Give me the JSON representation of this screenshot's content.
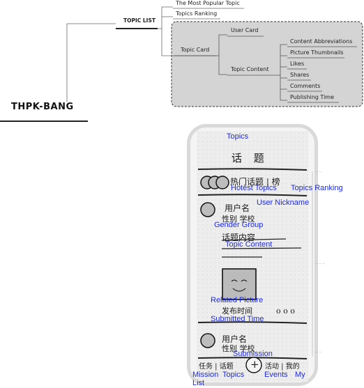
{
  "mindmap": {
    "root": "THPK-BANG",
    "topic_list": "TOPIC LIST",
    "most_popular": "The Most Popular Topic",
    "topics_ranking": "Topics Ranking",
    "topic_card": "Topic Card",
    "user_card": "User Card",
    "topic_content": "Topic Content",
    "content_items": [
      "Content Abbreviations",
      "Picture Thumbnails",
      "Likes",
      "Shares",
      "Comments",
      "Publishing Time"
    ]
  },
  "sketch": {
    "handwritten": {
      "title": "话 题",
      "hot_ranking": "热门话题 | 榜",
      "username": "用户名",
      "gender_school": "性别 学校",
      "topic_content": "话题内容",
      "submit_time": "发布时间",
      "dots": "o o o",
      "username2": "用户名",
      "gender_school2": "性别 学校",
      "bottom_left": "任务 | 话题",
      "plus": "+",
      "bottom_right": "活动 | 我的"
    },
    "annotations": {
      "topics": "Topics",
      "hotest_topics": "Hotest Topics",
      "topics_ranking": "Topics Ranking",
      "user_nickname": "User Nickname",
      "gender_group": "Gender Group",
      "topic_content": "Topic Content",
      "related_picture": "Related Picture",
      "submitted_time": "Submitted Time",
      "submission": "Submission",
      "mission_list": "Mission List",
      "topics_tab": "Topics",
      "events": "Events",
      "my": "My"
    }
  },
  "colors": {
    "annotation": "#1f2bd8",
    "group_fill": "#d4d4d4",
    "line": "#555555"
  }
}
